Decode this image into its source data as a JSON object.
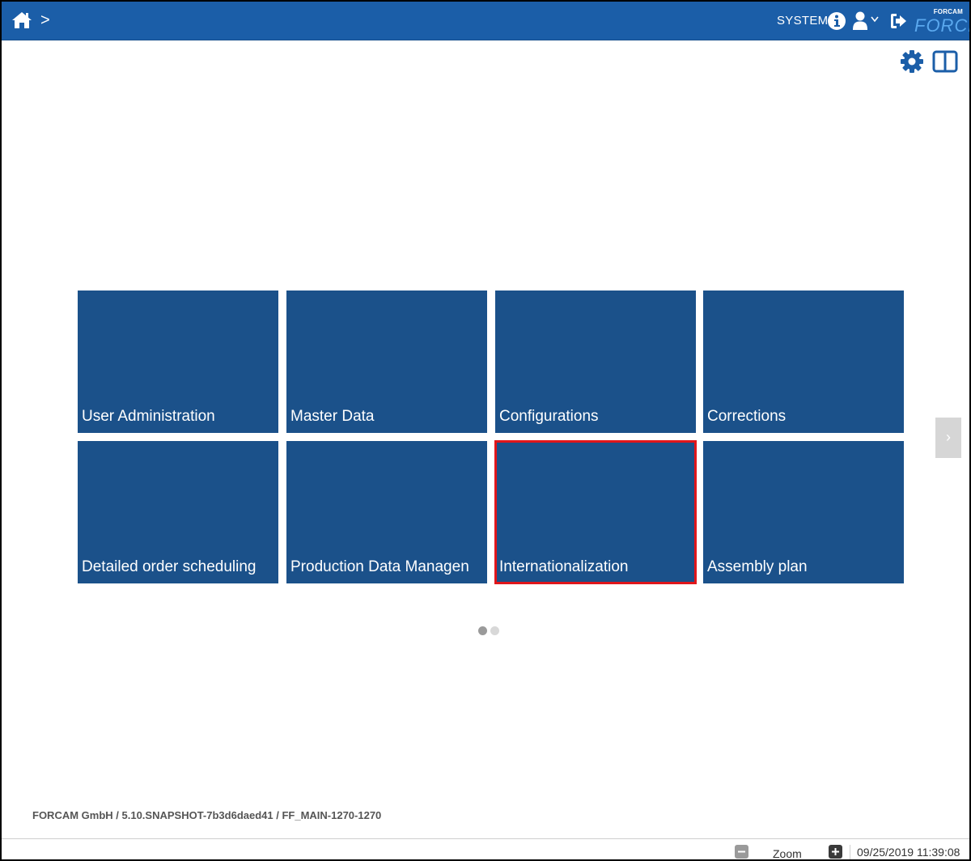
{
  "header": {
    "user_label": "SYSTEM",
    "logo_small": "FORCAM",
    "logo_big": "FORCE",
    "breadcrumb_separator": ">",
    "accent_color": "#1b5ea8"
  },
  "tiles": [
    {
      "label": "User Administration"
    },
    {
      "label": "Master Data"
    },
    {
      "label": "Configurations"
    },
    {
      "label": "Corrections"
    },
    {
      "label": "Detailed order scheduling"
    },
    {
      "label": "Production Data Managen"
    },
    {
      "label": "Internationalization",
      "selected": true
    },
    {
      "label": "Assembly plan"
    }
  ],
  "pagination": {
    "pages": 2,
    "current": 1,
    "next_label": "›"
  },
  "footer": {
    "version_text": "FORCAM GmbH / 5.10.SNAPSHOT-7b3d6daed41 / FF_MAIN-1270-1270"
  },
  "statusbar": {
    "zoom_label": "Zoom",
    "datetime": "09/25/2019 11:39:08"
  },
  "colors": {
    "tile": "#1b518a",
    "selected_outline": "#e0161b"
  }
}
